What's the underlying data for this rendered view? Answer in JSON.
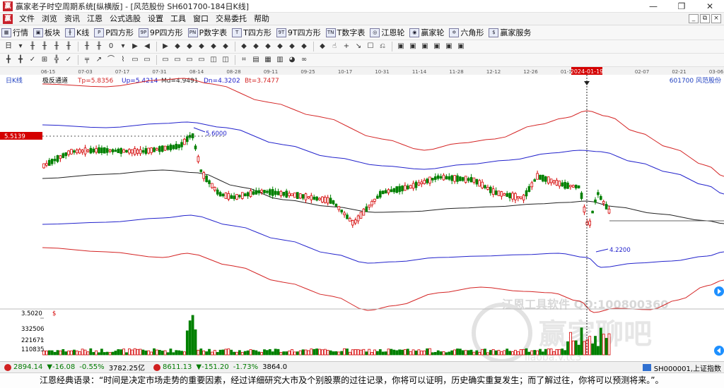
{
  "window": {
    "title": "赢家老子时空周期系统[纵横版] - [风范股份  SH601700-184日K线]",
    "logo": "赢",
    "controls": [
      "—",
      "❐",
      "✕"
    ]
  },
  "menu": {
    "logo": "赢",
    "items": [
      "文件",
      "浏览",
      "资讯",
      "江恩",
      "公式选股",
      "设置",
      "工具",
      "窗口",
      "交易委托",
      "帮助"
    ],
    "mdi": [
      "_",
      "⧉",
      "×"
    ]
  },
  "toolbar1": [
    {
      "icon": "grid-icon",
      "glyph": "▦",
      "label": "行情"
    },
    {
      "icon": "blocks-icon",
      "glyph": "▣",
      "label": "板块"
    },
    {
      "icon": "kline-icon",
      "glyph": "╫",
      "label": "K线"
    },
    {
      "icon": "p-square-icon",
      "glyph": "P",
      "label": "P四方形"
    },
    {
      "icon": "9p-square-icon",
      "glyph": "9P",
      "label": "9P四方形"
    },
    {
      "icon": "p-table-icon",
      "glyph": "PN",
      "label": "P数字表"
    },
    {
      "icon": "t-square-icon",
      "glyph": "T",
      "label": "T四方形"
    },
    {
      "icon": "9t-square-icon",
      "glyph": "9T",
      "label": "9T四方形"
    },
    {
      "icon": "t-table-icon",
      "glyph": "TN",
      "label": "T数字表"
    },
    {
      "icon": "gann-wheel-icon",
      "glyph": "◎",
      "label": "江恩轮"
    },
    {
      "icon": "winner-wheel-icon",
      "glyph": "◉",
      "label": "赢家轮"
    },
    {
      "icon": "hexagon-icon",
      "glyph": "✡",
      "label": "六角形"
    },
    {
      "icon": "service-icon",
      "glyph": "$",
      "label": "赢家服务"
    }
  ],
  "toolbar2": [
    "日",
    "▾",
    "╫",
    "╫",
    "╫",
    "╫",
    "╫",
    "╫",
    "0",
    "▾",
    "▶",
    "◀",
    "▶",
    "◆",
    "◆",
    "◆",
    "◆",
    "◆",
    "◆",
    "◆",
    "◆",
    "◆",
    "◆",
    "◆",
    "◆",
    "☝",
    "+",
    "↘",
    "☐",
    "⎌",
    "▣",
    "▣",
    "▣",
    "▣",
    "▣",
    "▣"
  ],
  "toolbar3": [
    "╋",
    "╋",
    "✓",
    "⊞",
    "╬",
    "✓",
    "╤",
    "↗",
    "⌒",
    "⌇",
    "▭",
    "▭",
    "▭",
    "▭",
    "▭",
    "▭",
    "◫",
    "◫",
    "⌗",
    "▤",
    "▦",
    "▥",
    "◕",
    "∞"
  ],
  "chart": {
    "panel_label": "日K线",
    "indicator_name": "极反通道",
    "tp": "Tp=5.8356",
    "up": "Up=5.4214",
    "md": "Md=4.9491",
    "dn": "Dn=4.3202",
    "bt": "Bt=3.7477",
    "stock": "601700  风范股份",
    "current_price_label": "5.5139",
    "high_label": "5.6000",
    "low_label": "4.2200",
    "cursor_date": "2024-01-19",
    "date_ticks": [
      "06-15",
      "07-03",
      "07-17",
      "07-31",
      "08-14",
      "08-28",
      "09-11",
      "09-25",
      "10-17",
      "10-31",
      "11-14",
      "11-28",
      "12-12",
      "12-26",
      "01-10",
      "",
      "02-07",
      "02-21",
      "03-06"
    ],
    "volume_axis_top": "3.5020",
    "volume_axis_labels": [
      "332506",
      "221671",
      "110835"
    ],
    "watermark_1": "江恩工具软件  QQ:100800360",
    "watermark_2": "赢家聊吧",
    "watermark_3": "liaoba.v.tc3"
  },
  "colors": {
    "candle_up": "#d40000",
    "candle_down": "#008000",
    "band_outer": "#d42424",
    "band_inner": "#2222cc",
    "midline": "#222222"
  },
  "indexbar": {
    "sh_value": "2894.14",
    "sh_change": "▼-16.08",
    "sh_pct": "-0.55%",
    "sh_amount": "3782.25亿",
    "sz_value": "8611.13",
    "sz_change": "▼-151.20",
    "sz_pct": "-1.73%",
    "sz_amount": "3864.0",
    "right_code": "SH000001,上证指数"
  },
  "quote": "江恩经典语录：“时间是决定市场走势的重要因素，经过详细研究大市及个别股票的过往记录，你将可以证明，历史确实重复发生；而了解过往，你将可以预测将来。”。"
}
